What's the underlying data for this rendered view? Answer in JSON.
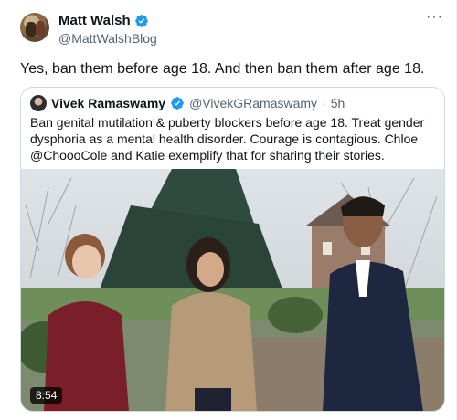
{
  "tweet": {
    "author": {
      "display_name": "Matt Walsh",
      "handle": "@MattWalshBlog",
      "verified": true,
      "avatar": "avatar"
    },
    "more_icon": "more-icon",
    "text": "Yes, ban them before age 18. And then ban them after age 18."
  },
  "quote": {
    "author": {
      "display_name": "Vivek Ramaswamy",
      "handle": "@VivekGRamaswamy",
      "separator": "·",
      "time": "5h",
      "verified": true
    },
    "text": "Ban genital mutilation & puberty blockers before age 18. Treat gender dysphoria as a mental health disorder.  Courage is contagious. Chloe @ChoooCole and Katie exemplify that for sharing their stories.",
    "media": {
      "type": "video",
      "duration": "8:54"
    }
  },
  "colors": {
    "verified_blue": "#1d9bf0",
    "secondary_text": "#536471",
    "border": "#cfd9de"
  }
}
